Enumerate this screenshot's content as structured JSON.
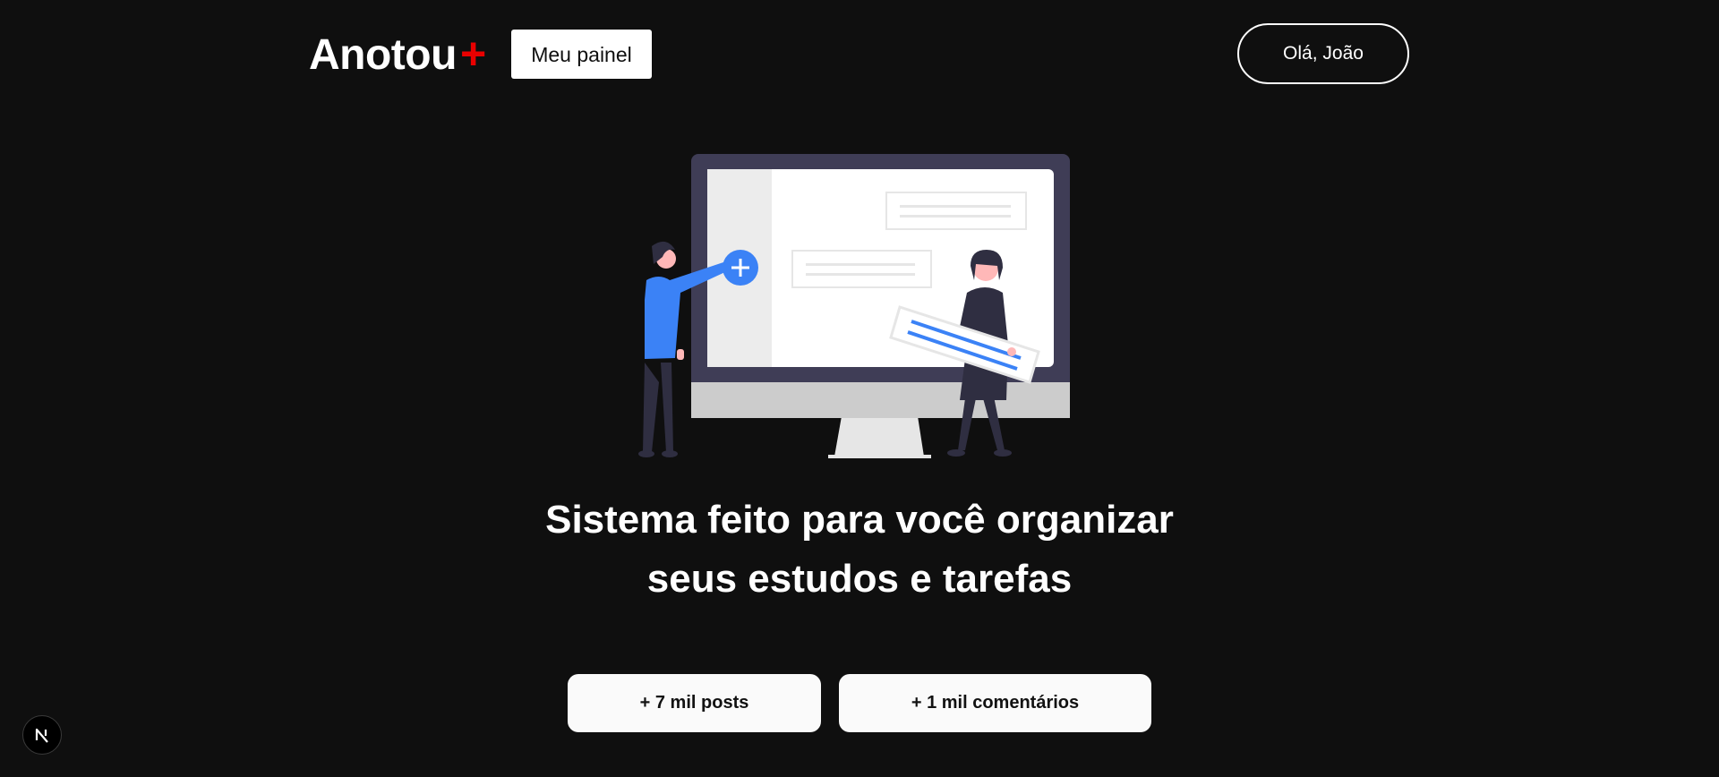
{
  "header": {
    "brand_name": "Anotou",
    "brand_plus": "+",
    "panel_button_label": "Meu painel",
    "user_button_label": "Olá, João"
  },
  "hero": {
    "title_line1": "Sistema feito para você organizar",
    "title_line2": "seus estudos e tarefas",
    "illustration_icon": "people-organizing-screen-illustration"
  },
  "stats": {
    "posts_label": "+ 7 mil posts",
    "comments_label": "+ 1 mil comentários"
  },
  "corner_badge": {
    "icon": "nextjs-n-icon",
    "letter": "N"
  },
  "colors": {
    "background": "#0f0f0f",
    "brand_accent": "#ea0000",
    "illustration_blue": "#3b82f6",
    "monitor_frame": "#3f3d56",
    "card_background": "#fafafa"
  }
}
